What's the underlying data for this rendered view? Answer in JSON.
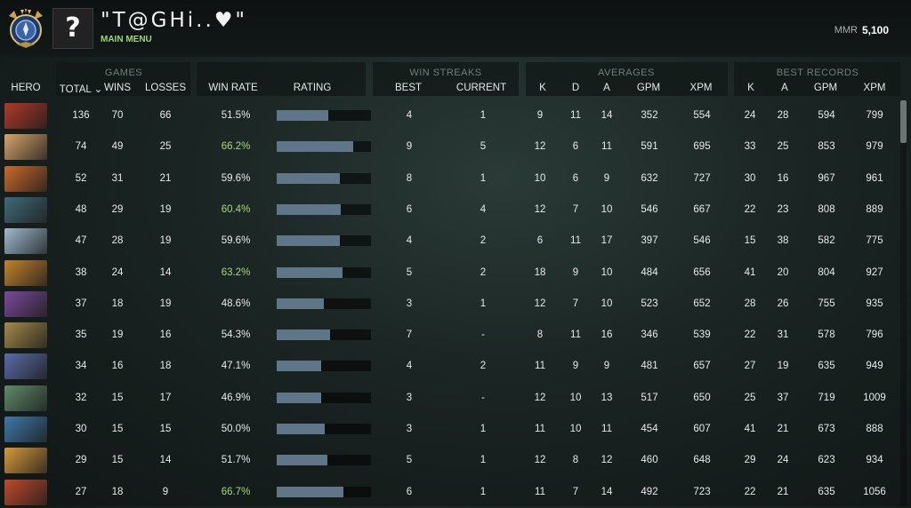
{
  "player": {
    "name": "\"T@GHi..♥\"",
    "subtitle": "MAIN MENU",
    "avatar_glyph": "?",
    "mmr_label": "MMR",
    "mmr_value": "5,100"
  },
  "groups": {
    "games": "GAMES",
    "win_streaks": "WIN STREAKS",
    "averages": "AVERAGES",
    "best_records": "BEST RECORDS"
  },
  "columns": {
    "hero": "HERO",
    "total": "TOTAL ⌄",
    "wins": "WINS",
    "losses": "LOSSES",
    "win_rate": "WIN RATE",
    "rating": "RATING",
    "best": "BEST",
    "current": "CURRENT",
    "avg_k": "K",
    "avg_d": "D",
    "avg_a": "A",
    "avg_gpm": "GPM",
    "avg_xpm": "XPM",
    "best_k": "K",
    "best_a": "A",
    "best_gpm": "GPM",
    "best_xpm": "XPM"
  },
  "rows": [
    {
      "total": "136",
      "wins": "70",
      "losses": "66",
      "win_rate": "51.5%",
      "rating": 0.55,
      "best": "4",
      "current": "1",
      "k": "9",
      "d": "11",
      "a": "14",
      "gpm": "352",
      "xpm": "554",
      "bk": "24",
      "ba": "28",
      "bgpm": "594",
      "bxpm": "799",
      "color": "#b03a2a"
    },
    {
      "total": "74",
      "wins": "49",
      "losses": "25",
      "win_rate": "66.2%",
      "rating": 0.81,
      "best": "9",
      "current": "5",
      "k": "12",
      "d": "6",
      "a": "11",
      "gpm": "591",
      "xpm": "695",
      "bk": "33",
      "ba": "25",
      "bgpm": "853",
      "bxpm": "979",
      "color": "#d6a46a"
    },
    {
      "total": "52",
      "wins": "31",
      "losses": "21",
      "win_rate": "59.6%",
      "rating": 0.67,
      "best": "8",
      "current": "1",
      "k": "10",
      "d": "6",
      "a": "9",
      "gpm": "632",
      "xpm": "727",
      "bk": "30",
      "ba": "16",
      "bgpm": "967",
      "bxpm": "961",
      "color": "#c96a2a"
    },
    {
      "total": "48",
      "wins": "29",
      "losses": "19",
      "win_rate": "60.4%",
      "rating": 0.68,
      "best": "6",
      "current": "4",
      "k": "12",
      "d": "7",
      "a": "10",
      "gpm": "546",
      "xpm": "667",
      "bk": "22",
      "ba": "23",
      "bgpm": "808",
      "bxpm": "889",
      "color": "#3f6b78"
    },
    {
      "total": "47",
      "wins": "28",
      "losses": "19",
      "win_rate": "59.6%",
      "rating": 0.67,
      "best": "4",
      "current": "2",
      "k": "6",
      "d": "11",
      "a": "17",
      "gpm": "397",
      "xpm": "546",
      "bk": "15",
      "ba": "38",
      "bgpm": "582",
      "bxpm": "775",
      "color": "#9fbbd0"
    },
    {
      "total": "38",
      "wins": "24",
      "losses": "14",
      "win_rate": "63.2%",
      "rating": 0.7,
      "best": "5",
      "current": "2",
      "k": "18",
      "d": "9",
      "a": "10",
      "gpm": "484",
      "xpm": "656",
      "bk": "41",
      "ba": "20",
      "bgpm": "804",
      "bxpm": "927",
      "color": "#c4822c"
    },
    {
      "total": "37",
      "wins": "18",
      "losses": "19",
      "win_rate": "48.6%",
      "rating": 0.5,
      "best": "3",
      "current": "1",
      "k": "12",
      "d": "7",
      "a": "10",
      "gpm": "523",
      "xpm": "652",
      "bk": "28",
      "ba": "26",
      "bgpm": "755",
      "bxpm": "935",
      "color": "#7a4a9a"
    },
    {
      "total": "35",
      "wins": "19",
      "losses": "16",
      "win_rate": "54.3%",
      "rating": 0.57,
      "best": "7",
      "current": "-",
      "k": "8",
      "d": "11",
      "a": "16",
      "gpm": "346",
      "xpm": "539",
      "bk": "22",
      "ba": "31",
      "bgpm": "578",
      "bxpm": "796",
      "color": "#a48a4a"
    },
    {
      "total": "34",
      "wins": "16",
      "losses": "18",
      "win_rate": "47.1%",
      "rating": 0.47,
      "best": "4",
      "current": "2",
      "k": "11",
      "d": "9",
      "a": "9",
      "gpm": "481",
      "xpm": "657",
      "bk": "27",
      "ba": "19",
      "bgpm": "635",
      "bxpm": "949",
      "color": "#5a6ca8"
    },
    {
      "total": "32",
      "wins": "15",
      "losses": "17",
      "win_rate": "46.9%",
      "rating": 0.47,
      "best": "3",
      "current": "-",
      "k": "12",
      "d": "10",
      "a": "13",
      "gpm": "517",
      "xpm": "650",
      "bk": "25",
      "ba": "37",
      "bgpm": "719",
      "bxpm": "1009",
      "color": "#5f8a6a"
    },
    {
      "total": "30",
      "wins": "15",
      "losses": "15",
      "win_rate": "50.0%",
      "rating": 0.51,
      "best": "3",
      "current": "1",
      "k": "11",
      "d": "10",
      "a": "11",
      "gpm": "454",
      "xpm": "607",
      "bk": "41",
      "ba": "21",
      "bgpm": "673",
      "bxpm": "888",
      "color": "#3f78a8"
    },
    {
      "total": "29",
      "wins": "15",
      "losses": "14",
      "win_rate": "51.7%",
      "rating": 0.54,
      "best": "5",
      "current": "1",
      "k": "12",
      "d": "8",
      "a": "12",
      "gpm": "460",
      "xpm": "648",
      "bk": "29",
      "ba": "24",
      "bgpm": "623",
      "bxpm": "934",
      "color": "#d89a3a"
    },
    {
      "total": "27",
      "wins": "18",
      "losses": "9",
      "win_rate": "66.7%",
      "rating": 0.71,
      "best": "6",
      "current": "1",
      "k": "11",
      "d": "7",
      "a": "14",
      "gpm": "492",
      "xpm": "723",
      "bk": "22",
      "ba": "21",
      "bgpm": "635",
      "bxpm": "1056",
      "color": "#c04a2a"
    }
  ],
  "colors": {
    "win_rate_high": "#a7d77f",
    "bar_fill": "#5e7688"
  }
}
